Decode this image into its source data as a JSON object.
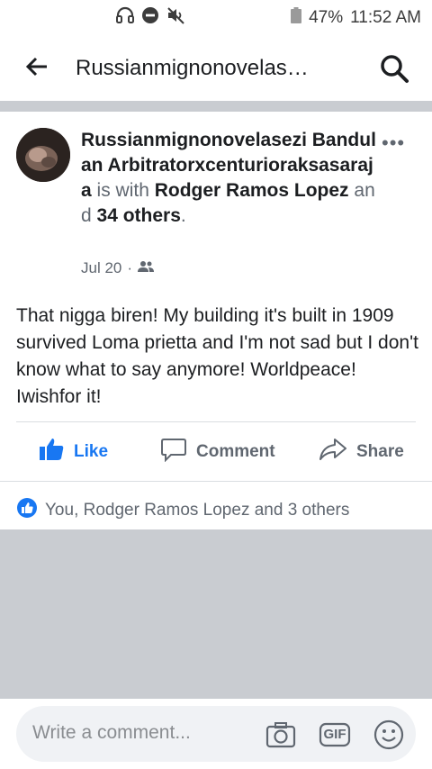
{
  "status_bar": {
    "battery": "47%",
    "time": "11:52 AM",
    "icons": [
      "headphones-icon",
      "do-not-disturb-icon",
      "mute-icon",
      "battery-icon"
    ]
  },
  "app_bar": {
    "title": "Russianmignonovelas…",
    "back_icon": "back-arrow-icon",
    "search_icon": "search-icon"
  },
  "post": {
    "author": "Russianmignonovelasezi Bandulan Arbitratorxcenturioraksasaraja",
    "with_text": " is with ",
    "tagged": "Rodger Ramos Lopez",
    "and_text": " and ",
    "others": "34 others",
    "period": ".",
    "date": "Jul 20",
    "dot": "·",
    "privacy_icon": "friends-icon",
    "more_icon": "more-options-icon",
    "text": "That nigga biren!  My  building it's built in 1909 survived Loma prietta and I'm not sad but I don't know what to say anymore!  Worldpeace!  Iwishfor it!"
  },
  "actions": {
    "like": "Like",
    "comment": "Comment",
    "share": "Share"
  },
  "reactions": {
    "text": "You, Rodger Ramos Lopez and 3 others",
    "icon": "like-reaction-icon"
  },
  "composer": {
    "placeholder": "Write a comment...",
    "icons": [
      "camera-icon",
      "gif-icon",
      "emoji-icon"
    ],
    "gif_label": "GIF"
  },
  "colors": {
    "brand_blue": "#1877f2",
    "muted": "#606770",
    "divider": "#c9ccd1"
  }
}
